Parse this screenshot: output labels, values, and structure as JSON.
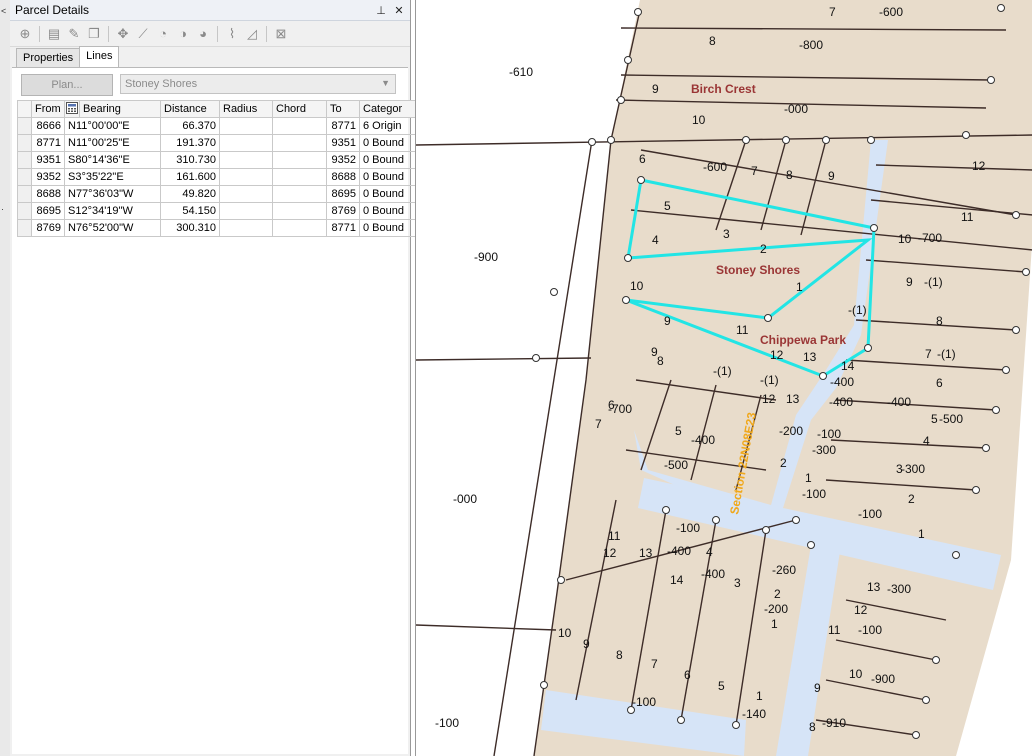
{
  "left_strip": {
    "glyph_top": "<",
    "glyph_mid": "·"
  },
  "panel": {
    "title": "Parcel Details",
    "pin_icon": "pin-icon",
    "close_icon": "close-icon",
    "tabs": [
      {
        "label": "Properties"
      },
      {
        "label": "Lines",
        "active": true
      }
    ],
    "plan_button": "Plan...",
    "plan_value": "Stoney Shores",
    "table": {
      "headers": [
        "",
        "From",
        "",
        "Bearing",
        "Distance",
        "Radius",
        "Chord",
        "To",
        "Category"
      ],
      "header_display": {
        "from": "From",
        "bearing": "Bearing",
        "distance": "Distance",
        "radius": "Radius",
        "chord": "Chord",
        "to": "To",
        "category": "Categor"
      },
      "rows": [
        {
          "from": "8666",
          "bearing": "N11°00'00\"E",
          "distance": "66.370",
          "radius": "",
          "chord": "",
          "to": "8771",
          "category": "6 Origin"
        },
        {
          "from": "8771",
          "bearing": "N11°00'25\"E",
          "distance": "191.370",
          "radius": "",
          "chord": "",
          "to": "9351",
          "category": "0 Bound"
        },
        {
          "from": "9351",
          "bearing": "S80°14'36\"E",
          "distance": "310.730",
          "radius": "",
          "chord": "",
          "to": "9352",
          "category": "0 Bound"
        },
        {
          "from": "9352",
          "bearing": "S3°35'22\"E",
          "distance": "161.600",
          "radius": "",
          "chord": "",
          "to": "8688",
          "category": "0 Bound"
        },
        {
          "from": "8688",
          "bearing": "N77°36'03\"W",
          "distance": "49.820",
          "radius": "",
          "chord": "",
          "to": "8695",
          "category": "0 Bound"
        },
        {
          "from": "8695",
          "bearing": "S12°34'19\"W",
          "distance": "54.150",
          "radius": "",
          "chord": "",
          "to": "8769",
          "category": "0 Bound"
        },
        {
          "from": "8769",
          "bearing": "N76°52'00\"W",
          "distance": "300.310",
          "radius": "",
          "chord": "",
          "to": "8771",
          "category": "0 Bound"
        }
      ]
    }
  },
  "map": {
    "colors": {
      "parcel": "#e8dccb",
      "road": "#d6e4f7",
      "line": "#3d2c28",
      "selection": "#22e5e5",
      "name": "#9a3535",
      "section": "#f0a81c"
    },
    "names": {
      "birch": "Birch Crest",
      "stoney": "Stoney Shores",
      "chippewa": "Chippewa Park",
      "section": "Section 22N08E23"
    },
    "labels": {
      "l7top": "7",
      "m600a": "-600",
      "l8": "8",
      "m800": "-800",
      "m610": "-610",
      "l9a": "9",
      "m000a": "-000",
      "l10a": "10",
      "l6": "6",
      "m600b": "-600",
      "l7b": "7",
      "l8b": "8",
      "l9b": "9",
      "l12": "12",
      "l11": "11",
      "l5": "5",
      "l3": "3",
      "l10b": "10",
      "m700a": "-700",
      "l4": "4",
      "l2": "2",
      "m900": "-900",
      "l9c": "9",
      "m1a": "-(1)",
      "l1a": "1",
      "l10c": "10",
      "m1b": "-(1)",
      "l9d": "9",
      "l8c": "8",
      "l11b": "11",
      "l7c": "7",
      "m1c": "-(1)",
      "l9e": "9",
      "l8d": "8",
      "l12b": "12",
      "l13": "13",
      "l14": "14",
      "m1d": "-(1)",
      "m400a": "-400",
      "m1e": "-(1)",
      "l6b": "6",
      "m400b": "-400",
      "l12c": "12",
      "l13b": "13",
      "m400c": "-400",
      "m700b": "-700",
      "l6c": "6",
      "l5b": "5",
      "m500a": "-500",
      "l7d": "7",
      "l5c": "5",
      "m400d": "-400",
      "m200a": "-200",
      "m100a": "-100",
      "l4b": "4",
      "m300a": "-300",
      "m300b": "-300",
      "l3b": "3",
      "m000b": "-000",
      "m500b": "-500",
      "l2b": "2",
      "l1b": "1",
      "m100b": "-100",
      "l2c": "2",
      "m100c": "-100",
      "l1c": "1",
      "l11c": "11",
      "l12d": "12",
      "l13c": "13",
      "m100d": "-100",
      "m400e": "-400",
      "l4c": "4",
      "l14b": "14",
      "m400f": "-400",
      "l3c": "3",
      "m260": "-260",
      "l2d": "2",
      "m200b": "-200",
      "l1d": "1",
      "l13d": "13",
      "m300c": "-300",
      "l12e": "12",
      "m100e": "-100",
      "l11d": "11",
      "l10d": "10",
      "l9f": "9",
      "l8e": "8",
      "l7e": "7",
      "l6d": "6",
      "l5d": "5",
      "m100f": "-100",
      "l1e": "1",
      "m140": "-140",
      "l9g": "9",
      "l10e": "10",
      "m900b": "-900",
      "l8f": "8",
      "m910": "-910",
      "m100g": "-100",
      "m700c": "-700",
      "l7f": "7"
    }
  }
}
